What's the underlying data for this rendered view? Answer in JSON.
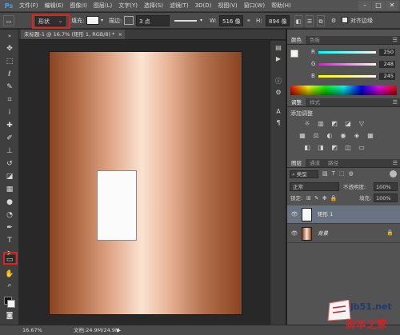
{
  "menubar": {
    "logo": "Ps",
    "items": [
      "文件(F)",
      "编辑(E)",
      "图像(I)",
      "图层(L)",
      "文字(Y)",
      "选择(S)",
      "滤镜(T)",
      "3D(D)",
      "视图(V)",
      "窗口(W)",
      "帮助(H)"
    ],
    "window_controls": [
      "–",
      "□",
      "✕"
    ]
  },
  "options": {
    "mode_value": "形状",
    "fill_label": "填充:",
    "stroke_label": "描边:",
    "stroke_size": "3 点",
    "w_label": "W:",
    "w_value": "516 像",
    "link_icon": "link-icon",
    "h_label": "H:",
    "h_value": "894 像",
    "align_edges_label": "对齐边缘"
  },
  "document": {
    "tab_title": "未标题-1 @ 16.7% (矩形 1, RGB/8) *",
    "tab_close": "×"
  },
  "color_panel": {
    "tabs": [
      "颜色",
      "色板"
    ],
    "sliders": [
      {
        "label": "R",
        "value": "250",
        "color": "#fa0000"
      },
      {
        "label": "G",
        "value": "248",
        "color": "#00f800"
      },
      {
        "label": "B",
        "value": "245",
        "color": "#0000f5"
      }
    ]
  },
  "adjustments_panel": {
    "tabs": [
      "调整",
      "样式"
    ],
    "title": "添加调整"
  },
  "layers_panel": {
    "tabs": [
      "图层",
      "通道",
      "路径"
    ],
    "filter_value": "类型",
    "blend_mode": "正常",
    "opacity_label": "不透明度:",
    "opacity_value": "100%",
    "lock_label": "锁定:",
    "fill_label": "填充:",
    "fill_value": "100%",
    "layers": [
      {
        "name": "矩形 1",
        "selected": true
      },
      {
        "name": "背景",
        "selected": false
      }
    ]
  },
  "statusbar": {
    "zoom": "16.67%",
    "doc_info": "文档:24.9M/24.9M"
  },
  "watermark": {
    "site": "jb51.net",
    "brand": "脚本之家"
  }
}
